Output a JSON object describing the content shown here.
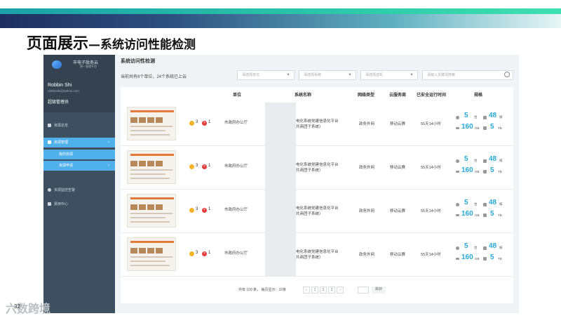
{
  "slide": {
    "title": "页面展示",
    "subtitle": "—系统访问性能检测",
    "page_number": "32",
    "brand": "六数跨境"
  },
  "sidebar": {
    "site_name": "市电子政务云",
    "site_sub": "统一管理平台",
    "user_name": "Robbin Shi",
    "user_email": "robbinshi@admin.com",
    "role": "超级管理员",
    "items": [
      {
        "label": "资源总览",
        "icon": "overview-icon"
      },
      {
        "label": "资源管理",
        "icon": "resource-icon",
        "active": true
      },
      {
        "label": "我的资源",
        "sub": true
      },
      {
        "label": "资源申请",
        "sub": true
      },
      {
        "label": "资源监控告警",
        "icon": "monitor-icon"
      },
      {
        "label": "费用中心",
        "icon": "billing-icon"
      }
    ]
  },
  "main": {
    "breadcrumb": "系统访问性检测",
    "summary": "当前共有8个单位，24个系统已上云",
    "filters": {
      "unit_placeholder": "请选择单位",
      "system_placeholder": "请选择系统",
      "vm_placeholder": "请选择虚机",
      "search_placeholder": "请输入关键词搜索"
    },
    "table": {
      "headers": [
        "单位",
        "系统名称",
        "网络类型",
        "云服务商",
        "已安全运行时间",
        "规格"
      ],
      "rows": [
        {
          "warn": "3",
          "err": "1",
          "unit": "市政府办公厅",
          "system_l1": "电化系统党建信息化平台",
          "system_l2": "共商团子系统）",
          "network": "政务外网",
          "provider": "移动云赛",
          "uptime": "55天14小时",
          "cpu": "5",
          "cpu_unit": "台",
          "mem": "48",
          "mem_unit": "核",
          "disk": "160",
          "disk_unit": "GB",
          "storage": "5",
          "storage_unit": "TB"
        },
        {
          "warn": "3",
          "err": "1",
          "unit": "市政府办公厅",
          "system_l1": "电化系统党建信息化平台",
          "system_l2": "共商团子系统）",
          "network": "政务外网",
          "provider": "移动云赛",
          "uptime": "55天14小时",
          "cpu": "5",
          "cpu_unit": "台",
          "mem": "48",
          "mem_unit": "核",
          "disk": "160",
          "disk_unit": "GB",
          "storage": "5",
          "storage_unit": "TB"
        },
        {
          "warn": "3",
          "err": "1",
          "unit": "市政府办公厅",
          "system_l1": "电化系统党建信息化平台",
          "system_l2": "共商团子系统）",
          "network": "政务外网",
          "provider": "移动云赛",
          "uptime": "55天14小时",
          "cpu": "5",
          "cpu_unit": "台",
          "mem": "48",
          "mem_unit": "核",
          "disk": "160",
          "disk_unit": "GB",
          "storage": "5",
          "storage_unit": "TB"
        },
        {
          "warn": "3",
          "err": "1",
          "unit": "市政府办公厅",
          "system_l1": "电化系统党建信息化平台",
          "system_l2": "共商团子系统）",
          "network": "政务外网",
          "provider": "移动云赛",
          "uptime": "55天14小时",
          "cpu": "5",
          "cpu_unit": "台",
          "mem": "48",
          "mem_unit": "核",
          "disk": "160",
          "disk_unit": "GB",
          "storage": "5",
          "storage_unit": "TB"
        }
      ]
    },
    "pager": {
      "summary": "共有 109 条，  每页显示：10条",
      "pages": [
        "‹",
        "1",
        "2",
        "3",
        "›"
      ],
      "jump_label": "跳转"
    }
  }
}
